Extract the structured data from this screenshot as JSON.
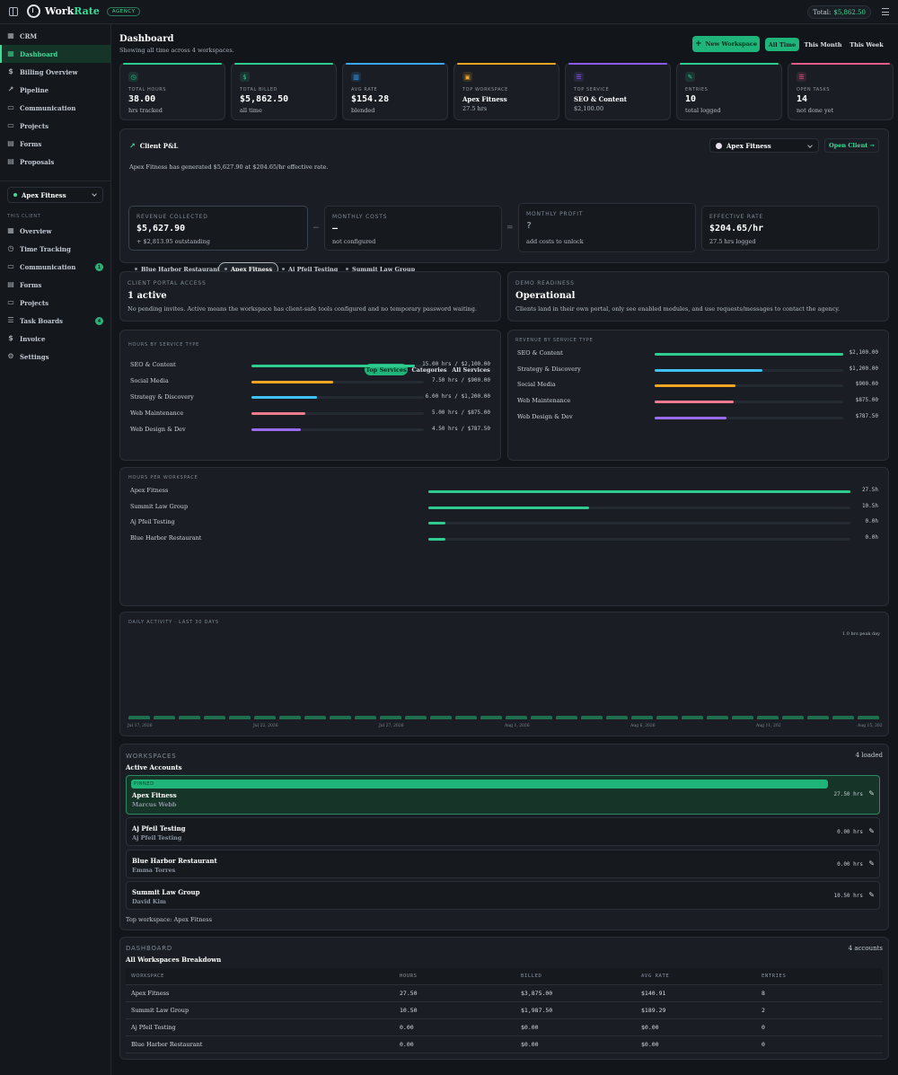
{
  "topbar": {
    "logo_work": "Work",
    "logo_rate": "Rate",
    "badge": "AGENCY",
    "total_label": "Total:",
    "total_value": "$5,862.50"
  },
  "sidebar": {
    "nav": [
      {
        "label": "CRM",
        "icon": "crm-icon"
      },
      {
        "label": "Dashboard",
        "icon": "dashboard-icon",
        "active": true
      },
      {
        "label": "Billing Overview",
        "icon": "dollar-icon"
      },
      {
        "label": "Pipeline",
        "icon": "trend-icon"
      },
      {
        "label": "Communication",
        "icon": "chat-icon"
      },
      {
        "label": "Projects",
        "icon": "folder-icon"
      },
      {
        "label": "Forms",
        "icon": "form-icon"
      },
      {
        "label": "Proposals",
        "icon": "proposal-icon"
      }
    ],
    "client_select": "Apex Fitness",
    "section_label": "THIS CLIENT",
    "client_nav": [
      {
        "label": "Overview"
      },
      {
        "label": "Time Tracking"
      },
      {
        "label": "Communication",
        "badge": "1"
      },
      {
        "label": "Forms"
      },
      {
        "label": "Projects"
      },
      {
        "label": "Task Boards",
        "badge": "4"
      },
      {
        "label": "Invoice"
      },
      {
        "label": "Settings"
      }
    ]
  },
  "header": {
    "title": "Dashboard",
    "subtitle": "Showing all time across 4 workspaces.",
    "new_workspace": "New Workspace",
    "ranges": [
      "All Time",
      "This Month",
      "This Week"
    ]
  },
  "stats": [
    {
      "label": "TOTAL HOURS",
      "value": "38.00",
      "sub": "hrs tracked",
      "color": "#2ecc8f",
      "icon": "clock-icon"
    },
    {
      "label": "TOTAL BILLED",
      "value": "$5,862.50",
      "sub": "all time",
      "color": "#2ecc8f",
      "icon": "dollar-icon"
    },
    {
      "label": "AVG RATE",
      "value": "$154.28",
      "sub": "blended",
      "color": "#3aa6ff",
      "icon": "chart-icon"
    },
    {
      "label": "TOP WORKSPACE",
      "value": "Apex Fitness",
      "sub": "27.5 hrs",
      "color": "#f0a623",
      "icon": "briefcase-icon"
    },
    {
      "label": "TOP SERVICE",
      "value": "SEO & Content",
      "sub": "$2,100.00",
      "color": "#8b5cf6",
      "icon": "list-icon"
    },
    {
      "label": "ENTRIES",
      "value": "10",
      "sub": "total logged",
      "color": "#2ecc8f",
      "icon": "pencil-icon"
    },
    {
      "label": "OPEN TASKS",
      "value": "14",
      "sub": "not done yet",
      "color": "#e85c8a",
      "icon": "tasks-icon"
    }
  ],
  "pnl": {
    "title": "Client P&L",
    "client": "Apex Fitness",
    "open_client": "Open Client →",
    "summary": "Apex Fitness has generated $5,627.90 at $204.65/hr effective rate.",
    "revenue_label": "REVENUE COLLECTED",
    "revenue_value": "$5,627.90",
    "revenue_sub": "+ $2,813.95 outstanding",
    "costs_label": "MONTHLY COSTS",
    "costs_value": "—",
    "costs_sub": "not configured",
    "profit_label": "MONTHLY PROFIT",
    "profit_value": "?",
    "profit_sub": "add costs to unlock",
    "rate_label": "EFFECTIVE RATE",
    "rate_value": "$204.65/hr",
    "rate_sub": "27.5 hrs logged",
    "minus": "−",
    "equals": "=",
    "chips": [
      "Blue Harbor Restaurant",
      "Apex Fitness",
      "Aj Pfeil Testing",
      "Summit Law Group"
    ]
  },
  "portal": {
    "kicker": "CLIENT PORTAL ACCESS",
    "title": "1 active",
    "text": "No pending invites. Active means the workspace has client-safe tools configured and no temporary password waiting."
  },
  "demo": {
    "kicker": "DEMO READINESS",
    "title": "Operational",
    "text": "Clients land in their own portal, only see enabled modules, and use requests/messages to contact the agency."
  },
  "hours_by_service": {
    "kicker": "HOURS BY SERVICE TYPE",
    "toggles": [
      "Top Services",
      "Categories",
      "All Services"
    ],
    "rows": [
      {
        "label": "SEO & Content",
        "value": "15.00 hrs / $2,100.00",
        "frac": 1.0,
        "color": "#2ecc8f"
      },
      {
        "label": "Social Media",
        "value": "7.50 hrs / $900.00",
        "frac": 0.5,
        "color": "#f0a623"
      },
      {
        "label": "Strategy & Discovery",
        "value": "6.00 hrs / $1,200.00",
        "frac": 0.4,
        "color": "#3ec0f0"
      },
      {
        "label": "Web Maintenance",
        "value": "5.00 hrs / $875.00",
        "frac": 0.33,
        "color": "#f07b8c"
      },
      {
        "label": "Web Design & Dev",
        "value": "4.50 hrs / $787.50",
        "frac": 0.3,
        "color": "#9b6cf0"
      }
    ]
  },
  "revenue_by_service": {
    "kicker": "REVENUE BY SERVICE TYPE",
    "rows": [
      {
        "label": "SEO & Content",
        "value": "$2,100.00",
        "frac": 1.0,
        "color": "#2ecc8f"
      },
      {
        "label": "Strategy & Discovery",
        "value": "$1,200.00",
        "frac": 0.57,
        "color": "#3ec0f0"
      },
      {
        "label": "Social Media",
        "value": "$900.00",
        "frac": 0.43,
        "color": "#f0a623"
      },
      {
        "label": "Web Maintenance",
        "value": "$875.00",
        "frac": 0.42,
        "color": "#f07b8c"
      },
      {
        "label": "Web Design & Dev",
        "value": "$787.50",
        "frac": 0.38,
        "color": "#9b6cf0"
      }
    ]
  },
  "hours_per_workspace": {
    "kicker": "HOURS PER WORKSPACE",
    "rows": [
      {
        "label": "Apex Fitness",
        "value": "27.5h",
        "frac": 1.0
      },
      {
        "label": "Summit Law Group",
        "value": "10.5h",
        "frac": 0.38
      },
      {
        "label": "Aj Pfeil Testing",
        "value": "0.0h",
        "frac": 0.04
      },
      {
        "label": "Blue Harbor Restaurant",
        "value": "0.0h",
        "frac": 0.04
      }
    ]
  },
  "daily_activity": {
    "kicker": "DAILY ACTIVITY · LAST 30 DAYS",
    "peak": "1.0 hrs peak day",
    "dates": [
      "Jul 17, 2026",
      "Jul 22, 2026",
      "Jul 27, 2026",
      "Aug 1, 2026",
      "Aug 6, 2026",
      "Aug 11, 202",
      "Aug 15, 202"
    ]
  },
  "workspaces": {
    "kicker": "WORKSPACES",
    "title": "Active Accounts",
    "count": "4 loaded",
    "pinned_label": "PINNED",
    "rows": [
      {
        "name": "Apex Fitness",
        "owner": "Marcus Webb",
        "hours": "27.50 hrs",
        "pinned": true
      },
      {
        "name": "Aj Pfeil Testing",
        "owner": "Aj Pfeil Testing",
        "hours": "0.00 hrs"
      },
      {
        "name": "Blue Harbor Restaurant",
        "owner": "Emma Torres",
        "hours": "0.00 hrs"
      },
      {
        "name": "Summit Law Group",
        "owner": "David Kim",
        "hours": "10.50 hrs"
      }
    ],
    "footer": "Top workspace: Apex Fitness"
  },
  "breakdown": {
    "kicker": "DASHBOARD",
    "title": "All Workspaces Breakdown",
    "count": "4 accounts",
    "headers": [
      "WORKSPACE",
      "HOURS",
      "BILLED",
      "AVG RATE",
      "ENTRIES"
    ],
    "rows": [
      [
        "Apex Fitness",
        "27.50",
        "$3,875.00",
        "$140.91",
        "8"
      ],
      [
        "Summit Law Group",
        "10.50",
        "$1,987.50",
        "$189.29",
        "2"
      ],
      [
        "Aj Pfeil Testing",
        "0.00",
        "$0.00",
        "$0.00",
        "0"
      ],
      [
        "Blue Harbor Restaurant",
        "0.00",
        "$0.00",
        "$0.00",
        "0"
      ]
    ]
  }
}
